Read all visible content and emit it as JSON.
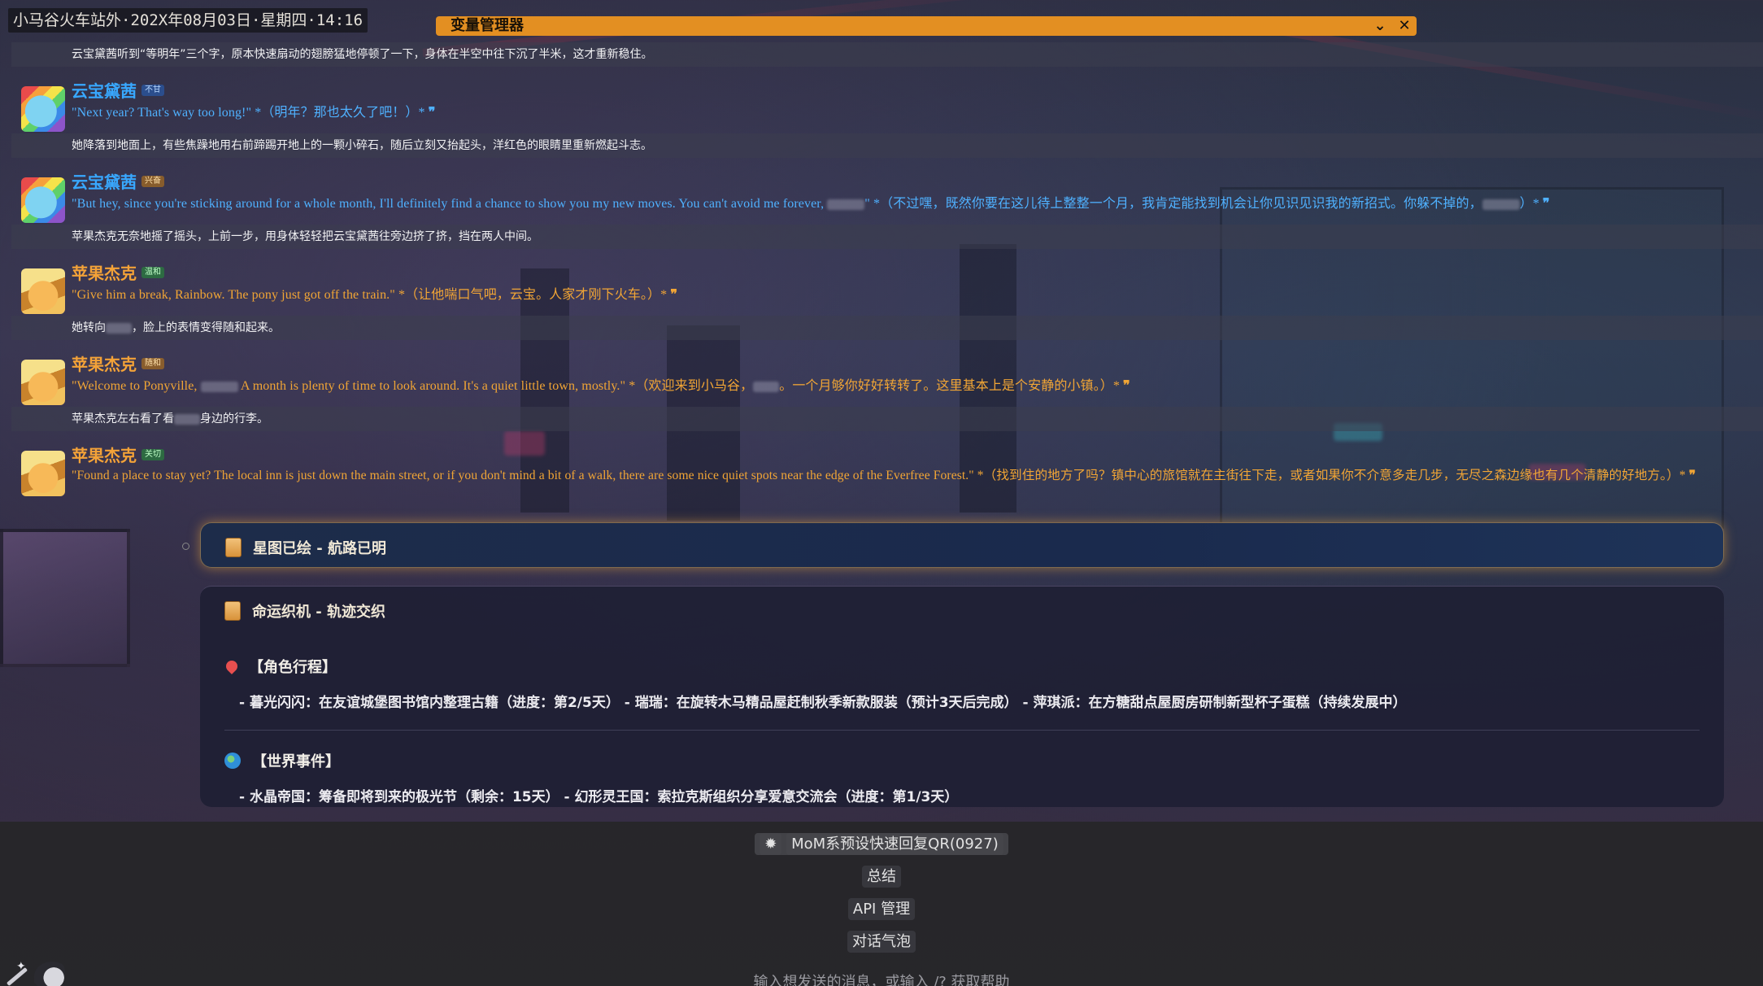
{
  "topbar": {
    "location_time": "小马谷火车站外·202X年08月03日·星期四·14:16"
  },
  "variable_manager": {
    "title": "变量管理器",
    "collapse_icon": "chevron-down-icon",
    "close_icon": "close-icon",
    "collapse_glyph": "⌄",
    "close_glyph": "✕"
  },
  "messages": [
    {
      "type": "narration",
      "text": "云宝黛茜听到“等明年”三个字，原本快速扇动的翅膀猛地停顿了一下，身体在半空中往下沉了半米，这才重新稳住。"
    },
    {
      "type": "speech",
      "speaker": "rainbow",
      "name": "云宝黛茜",
      "badge": "不甘",
      "parts": [
        "\"Next year? That's way too long!\" *（明年？那也太久了吧！）* ",
        "❞"
      ]
    },
    {
      "type": "narration",
      "text": "她降落到地面上，有些焦躁地用右前蹄踢开地上的一颗小碎石，随后立刻又抬起头，洋红色的眼睛里重新燃起斗志。"
    },
    {
      "type": "speech",
      "speaker": "rainbow",
      "name": "云宝黛茜",
      "badge": "兴奋",
      "parts": [
        "\"But hey, since you're sticking around for a whole month, I'll definitely find a chance to show you my new moves. You can't avoid me forever, ",
        "\" *（不过嘿，既然你要在这儿待上整整一个月，我肯定能找到机会让你见识见识我的新招式。你躲不掉的，",
        "）* ",
        "❞"
      ]
    },
    {
      "type": "narration",
      "text": "苹果杰克无奈地摇了摇头，上前一步，用身体轻轻把云宝黛茜往旁边挤了挤，挡在两人中间。"
    },
    {
      "type": "speech",
      "speaker": "applejack",
      "name": "苹果杰克",
      "badge": "温和",
      "parts": [
        "\"Give him a break, Rainbow. The pony just got off the train.\" *（让他喘口气吧，云宝。人家才刚下火车。）* ",
        "❞"
      ]
    },
    {
      "type": "narration",
      "text_a": "她转向",
      "text_b": "，脸上的表情变得随和起来。"
    },
    {
      "type": "speech",
      "speaker": "applejack",
      "name": "苹果杰克",
      "badge": "随和",
      "parts": [
        "\"Welcome to Ponyville, ",
        " A month is plenty of time to look around. It's a quiet little town, mostly.\" *（欢迎来到小马谷，",
        "。一个月够你好好转转了。这里基本上是个安静的小镇。）* ",
        "❞"
      ]
    },
    {
      "type": "narration",
      "text_a": "苹果杰克左右看了看",
      "text_b": "身边的行李。"
    },
    {
      "type": "speech",
      "speaker": "applejack",
      "name": "苹果杰克",
      "badge": "关切",
      "parts": [
        "\"Found a place to stay yet? The local inn is just down the main street, or if you don't mind a bit of a walk, there are some nice quiet spots near the edge of the Everfree Forest.\" *（找到住的地方了吗？镇中心的旅馆就在主街往下走，或者如果你不介意多走几步，无尽之森边缘也有几个清静的好地方。）* ",
        "❞"
      ]
    }
  ],
  "cards": {
    "star": {
      "title": "星图已绘 - 航路已明",
      "icon": "scroll-icon"
    },
    "fate": {
      "title": "命运织机 - 轨迹交织",
      "icon": "scroll-icon",
      "sections": [
        {
          "icon": "pin-icon",
          "heading": "【角色行程】",
          "body": "- 暮光闪闪：在友谊城堡图书馆内整理古籍（进度：第2/5天） - 瑞瑞：在旋转木马精品屋赶制秋季新款服装（预计3天后完成） - 萍琪派：在方糖甜点屋厨房研制新型杯子蛋糕（持续发展中）"
        },
        {
          "icon": "globe-icon",
          "heading": "【世界事件】",
          "body": "- 水晶帝国：筹备即将到来的极光节（剩余：15天） - 幻形灵王国：索拉克斯组织分享爱意交流会（进度：第1/3天）"
        }
      ]
    }
  },
  "quick_replies": [
    {
      "label": "MoM系预设快速回复QR(0927)",
      "icon": "gear-icon",
      "glyph": "✹"
    },
    {
      "label": "总结"
    },
    {
      "label": "API 管理"
    },
    {
      "label": "对话气泡"
    }
  ],
  "input": {
    "placeholder": "输入想发送的消息，或输入 /? 获取帮助"
  },
  "toolbar": {
    "left_icons": [
      "magic-wand-icon",
      "pony-avatar-icon"
    ]
  },
  "colors": {
    "accent": "#e38f22",
    "rainbow": "#4fb1ff",
    "applejack": "#f1a535"
  }
}
